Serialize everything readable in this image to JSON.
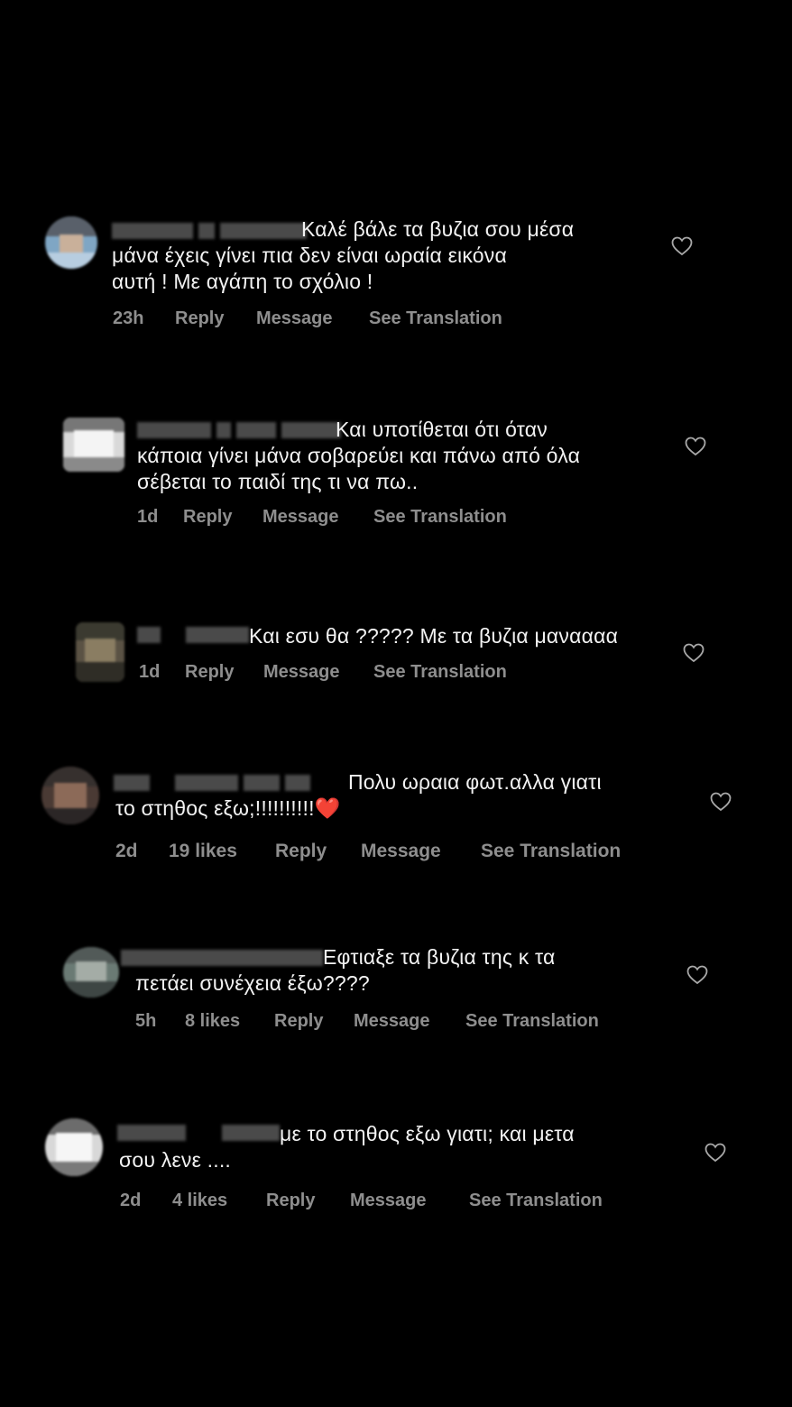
{
  "comments": [
    {
      "text": "Καλέ βάλε τα βυζια σου μέσα\nμάνα έχεις γίνει πια δεν είναι ωραία εικόνα\nαυτή ! Με αγάπη το σχόλιο !",
      "time": "23h",
      "likes": "",
      "reply": "Reply",
      "message": "Message",
      "translation": "See Translation"
    },
    {
      "text": "Και υποτίθεται ότι όταν\nκάποια γίνει μάνα σοβαρεύει και πάνω από όλα\nσέβεται το παιδί της τι να πω..",
      "time": "1d",
      "likes": "",
      "reply": "Reply",
      "message": "Message",
      "translation": "See Translation"
    },
    {
      "text": "Και εσυ θα ????? Με τα βυζια μαναααα",
      "time": "1d",
      "likes": "",
      "reply": "Reply",
      "message": "Message",
      "translation": "See Translation"
    },
    {
      "text": "Πολυ ωραια φωτ.αλλα γιατι\nτο στηθος εξω;!!!!!!!!!!❤️",
      "time": "2d",
      "likes": "19 likes",
      "reply": "Reply",
      "message": "Message",
      "translation": "See Translation"
    },
    {
      "text": "Εφτιαξε τα βυζια της κ τα\nπετάει συνέχεια έξω????",
      "time": "5h",
      "likes": "8 likes",
      "reply": "Reply",
      "message": "Message",
      "translation": "See Translation"
    },
    {
      "text": "με το στηθος εξω γιατι; και μετα\nσου λενε ....",
      "time": "2d",
      "likes": "4 likes",
      "reply": "Reply",
      "message": "Message",
      "translation": "See Translation"
    }
  ],
  "icons": {
    "like": "heart-outline-icon"
  },
  "colors": {
    "background": "#000000",
    "text": "#f2f2f2",
    "meta": "#8e8e8e"
  }
}
